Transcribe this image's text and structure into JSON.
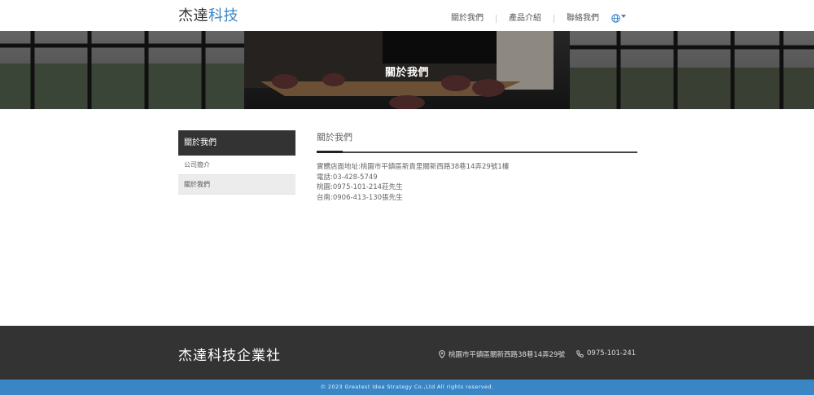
{
  "header": {
    "logo_main": "杰達",
    "logo_accent": "科技",
    "nav": [
      {
        "label": "關於我們"
      },
      {
        "label": "產品介紹"
      },
      {
        "label": "聯絡我們"
      }
    ],
    "language_icon": "globe-icon",
    "accent_color": "#3a86c5"
  },
  "banner": {
    "title": "關於我們"
  },
  "sidebar": {
    "heading": "關於我們",
    "items": [
      {
        "label": "公司簡介"
      },
      {
        "label": "關於我們"
      }
    ]
  },
  "main": {
    "title": "關於我們",
    "lines": [
      "實體店面地址:桃園市平鎮區新貴里關新西路38巷14弄29號1樓",
      "電話:03-428-5749",
      "桃園:0975-101-214莊先生",
      "台南:0906-413-130張先生"
    ]
  },
  "footer": {
    "brand": "杰達科技企業社",
    "address": "桃園市平鎮區關新西路38巷14弄29號",
    "phone": "0975-101-241",
    "address_icon": "map-pin-icon",
    "phone_icon": "phone-icon",
    "copyright": "© 2023 Greatest Idea Strategy Co.,Ltd All rights reserved."
  }
}
